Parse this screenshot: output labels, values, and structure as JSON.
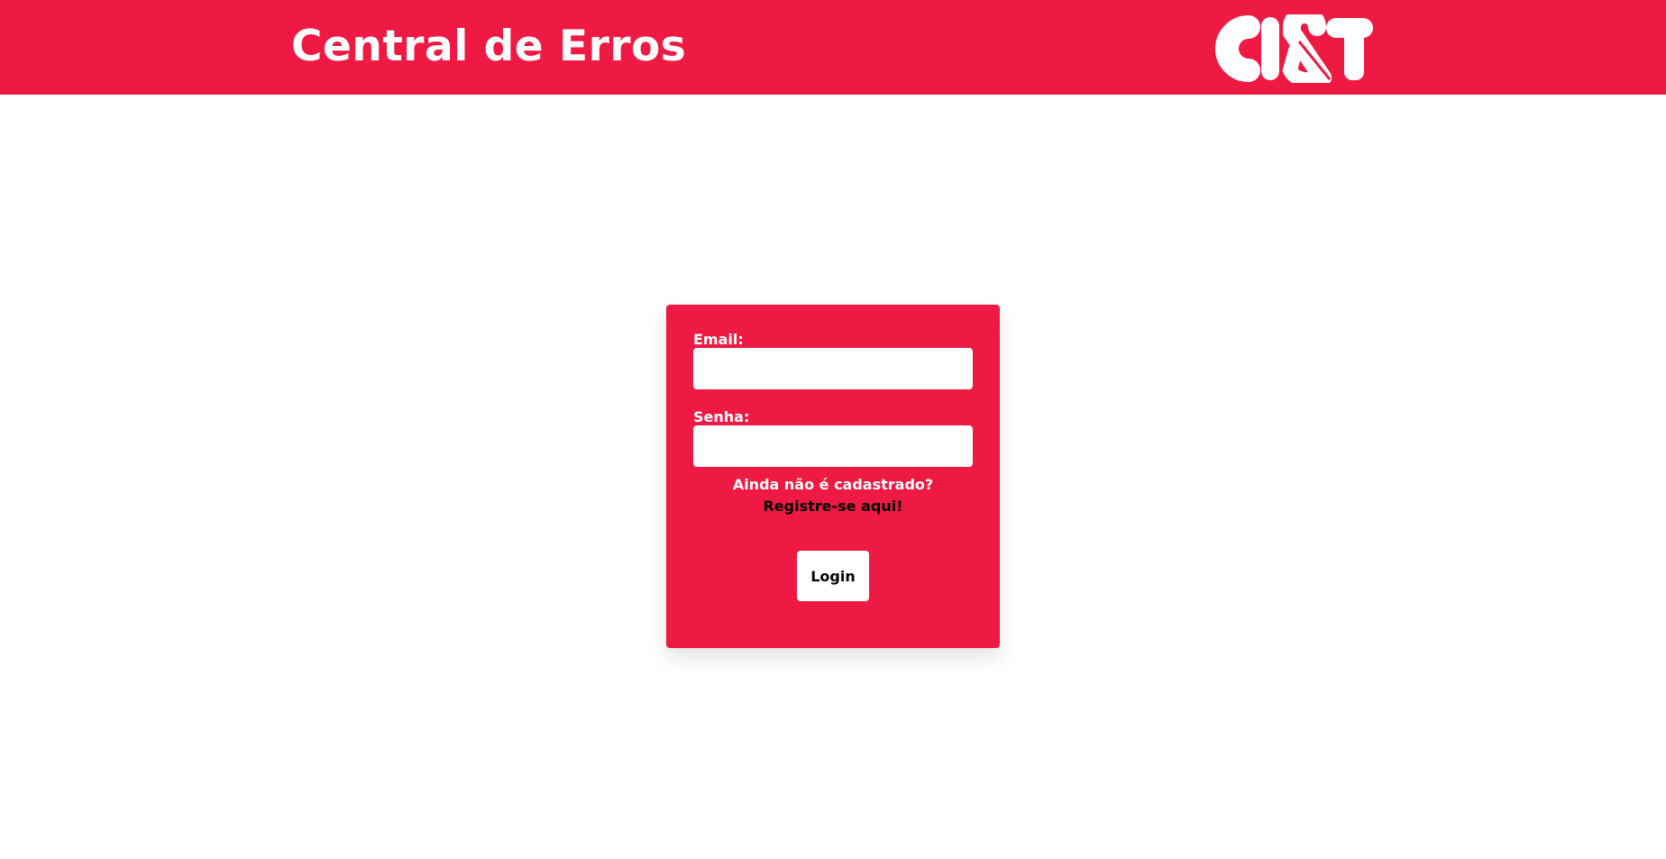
{
  "header": {
    "title": "Central de Erros",
    "logo_text": "CI&T"
  },
  "login": {
    "email_label": "Email:",
    "email_value": "",
    "password_label": "Senha:",
    "password_value": "",
    "signup_question": "Ainda não é cadastrado?",
    "signup_link": "Registre-se aqui!",
    "submit_label": "Login"
  },
  "colors": {
    "brand": "#ef1a43",
    "surface": "#ffffff",
    "link": "#000000"
  }
}
